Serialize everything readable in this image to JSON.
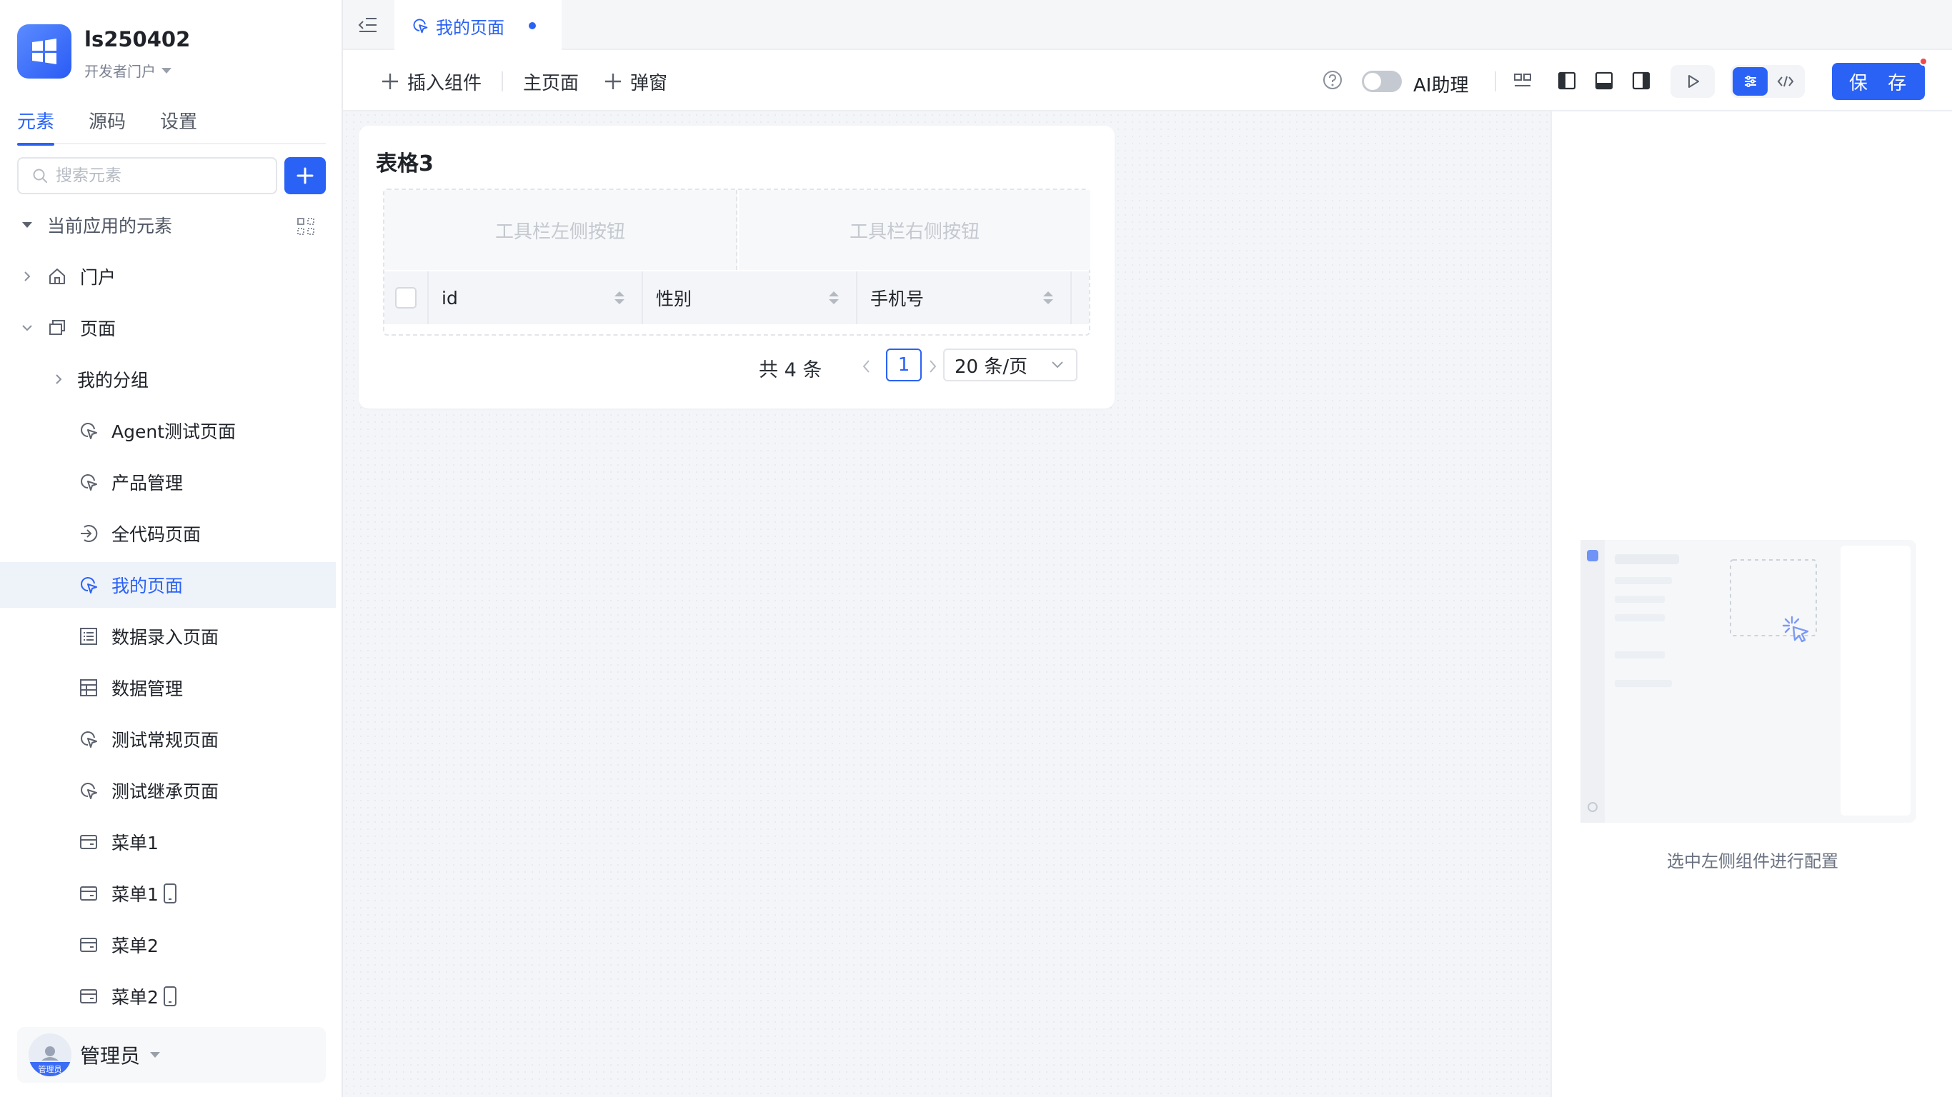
{
  "app": {
    "name": "ls250402",
    "portal": "开发者门户"
  },
  "sidebar": {
    "tabs": [
      {
        "label": "元素",
        "active": true
      },
      {
        "label": "源码",
        "active": false
      },
      {
        "label": "设置",
        "active": false
      }
    ],
    "search_placeholder": "搜索元素",
    "section_label": "当前应用的元素",
    "tree": [
      {
        "label": "门户",
        "icon": "home-icon"
      },
      {
        "label": "页面",
        "icon": "pages-icon"
      },
      {
        "label": "我的分组"
      },
      {
        "label": "Agent测试页面",
        "icon": "page-icon"
      },
      {
        "label": "产品管理",
        "icon": "page-icon"
      },
      {
        "label": "全代码页面",
        "icon": "code-page-icon"
      },
      {
        "label": "我的页面",
        "icon": "page-icon",
        "selected": true
      },
      {
        "label": "数据录入页面",
        "icon": "form-icon"
      },
      {
        "label": "数据管理",
        "icon": "table-icon"
      },
      {
        "label": "测试常规页面",
        "icon": "page-icon"
      },
      {
        "label": "测试继承页面",
        "icon": "page-icon"
      },
      {
        "label": "菜单1",
        "icon": "menu-icon"
      },
      {
        "label": "菜单1",
        "icon": "menu-icon",
        "mobile": true
      },
      {
        "label": "菜单2",
        "icon": "menu-icon"
      },
      {
        "label": "菜单2",
        "icon": "menu-icon",
        "mobile": true
      }
    ],
    "user": {
      "name": "管理员",
      "avatar_tag": "管理员"
    }
  },
  "tabbar": {
    "active_tab": "我的页面",
    "unsaved": true
  },
  "toolbar": {
    "insert_component": "插入组件",
    "main_page": "主页面",
    "popup": "弹窗",
    "ai_assistant": "AI助理",
    "ai_enabled": false,
    "save": "保 存"
  },
  "canvas": {
    "card_title": "表格3",
    "toolbar_left_slot": "工具栏左侧按钮",
    "toolbar_right_slot": "工具栏右侧按钮",
    "columns": [
      "id",
      "性别",
      "手机号"
    ],
    "total": "共 4 条",
    "current_page": "1",
    "page_size": "20 条/页"
  },
  "config_panel": {
    "hint": "选中左侧组件进行配置"
  },
  "colors": {
    "accent": "#2a62f5",
    "selected_bg": "#eef2f9",
    "canvas_bg": "#f3f5f8",
    "unsaved_dot": "#f5484a"
  }
}
